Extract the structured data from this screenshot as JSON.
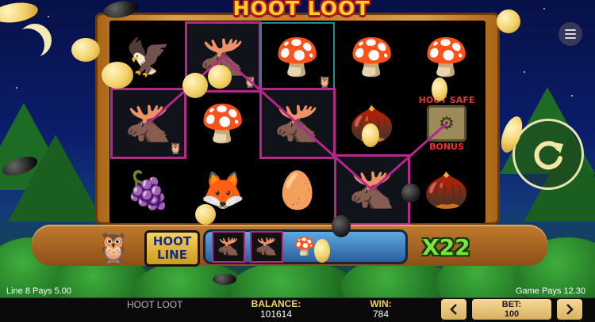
{
  "game": {
    "logo_text": "HOOT LOOT",
    "menu_icon": "hamburger-menu-icon",
    "spin_icon": "spin-arrow-icon"
  },
  "reels": [
    [
      "eagle",
      "moose-owl",
      "raspberry"
    ],
    [
      "moose-owl",
      "mushroom",
      "fox"
    ],
    [
      "mushroom-owl",
      "moose",
      "eggs-nest"
    ],
    [
      "mushroom",
      "acorn",
      "moose"
    ],
    [
      "mushroom",
      "hoot-safe-bonus",
      "acorn"
    ]
  ],
  "winning_cells": [
    "0-1",
    "1-0",
    "2-1",
    "3-2"
  ],
  "bonus_symbol": {
    "top": "HOOT SAFE",
    "bottom": "BONUS"
  },
  "win_display": {
    "hoot_line_1": "HOOT",
    "hoot_line_2": "LINE",
    "symbols": [
      "moose",
      "moose",
      "mushroom"
    ],
    "multiplier": "X22"
  },
  "status": {
    "line_pays": "Line 8 Pays 5.00",
    "game_pays": "Game Pays 12.30"
  },
  "bottom_bar": {
    "game_name": "HOOT LOOT",
    "balance_label": "BALANCE:",
    "balance_value": "101614",
    "win_label": "WIN:",
    "win_value": "784",
    "bet_label": "BET:",
    "bet_value": "100",
    "prev_icon": "chevron-left-icon",
    "next_icon": "chevron-right-icon"
  },
  "colors": {
    "win_outline": "#b5288a",
    "multiplier": "#7be33b",
    "logo": "#ffd02a"
  }
}
